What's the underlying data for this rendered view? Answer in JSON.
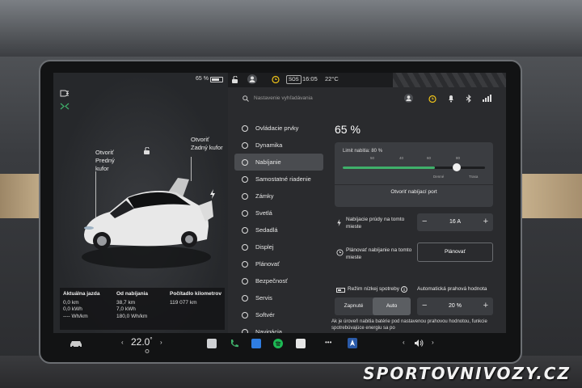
{
  "watermark": "SPORTOVNIVOZY.CZ",
  "status": {
    "battery_pct": "65 %",
    "time": "16:05",
    "outside_temp": "22°C",
    "sos": "SOS"
  },
  "search": {
    "placeholder": "Nastavenie vyhľadávania"
  },
  "car_panel": {
    "frunk_label": "Otvoriť\nPredný\nkufor",
    "trunk_label": "Otvoriť\nZadný kufor",
    "stats": [
      {
        "title": "Aktuálna jazda",
        "lines": [
          "0,0 km",
          "0,0 kWh",
          "---- Wh/km"
        ]
      },
      {
        "title": "Od nabíjania",
        "lines": [
          "38,7 km",
          "7,0 kWh",
          "180,0 Wh/km"
        ]
      },
      {
        "title": "Počítadlo kilometrov",
        "lines": [
          "119 077 km"
        ]
      }
    ]
  },
  "menu": {
    "items": [
      {
        "label": "Ovládacie prvky",
        "icon": "toggle-icon"
      },
      {
        "label": "Dynamika",
        "icon": "car-icon"
      },
      {
        "label": "Nabíjanie",
        "icon": "bolt-icon",
        "active": true
      },
      {
        "label": "Samostatné riadenie",
        "icon": "steering-wheel-icon"
      },
      {
        "label": "Zámky",
        "icon": "lock-icon"
      },
      {
        "label": "Svetlá",
        "icon": "sun-icon"
      },
      {
        "label": "Sedadlá",
        "icon": "seat-icon"
      },
      {
        "label": "Displej",
        "icon": "display-icon"
      },
      {
        "label": "Plánovať",
        "icon": "clock-icon"
      },
      {
        "label": "Bezpečnosť",
        "icon": "shield-icon"
      },
      {
        "label": "Servis",
        "icon": "wrench-icon"
      },
      {
        "label": "Softvér",
        "icon": "download-icon"
      },
      {
        "label": "Navigácia",
        "icon": "navigation-icon"
      }
    ]
  },
  "charging": {
    "battery_pct": "65 %",
    "limit_label": "Limit nabitia: 80 %",
    "limit_value_pct": 80,
    "current_charge_pct": 65,
    "ticks": [
      "50",
      "40",
      "60",
      "80",
      "80"
    ],
    "segment_labels": [
      "Denné",
      "Trasa"
    ],
    "open_port_label": "Otvoriť nabíjací port",
    "current_row_label": "Nabíjacie prúdy na tomto mieste",
    "current_value": "16 A",
    "schedule_row_label": "Plánovať nabíjanie na tomto mieste",
    "schedule_button": "Plánovať",
    "low_power_label": "Režim nízkej spotreby",
    "low_power_options": [
      "Zapnuté",
      "Auto"
    ],
    "low_power_selected": "Auto",
    "auto_threshold_label": "Automatická prahová hodnota",
    "auto_threshold_value": "20 %",
    "footer_text": "Ak je úroveň nabitia batérie pod nastavenou prahovou hodnotou, funkcie spotrebúvajúce energiu sa po"
  },
  "taskbar": {
    "temperature": "22.0",
    "temp_unit": "°"
  }
}
